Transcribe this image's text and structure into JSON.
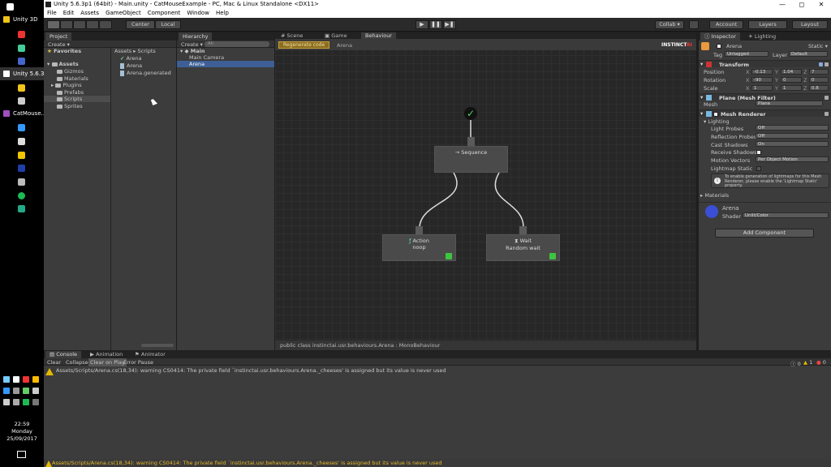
{
  "taskbar": {
    "apps": [
      {
        "label": "Unity 3D",
        "color": "#f0c419"
      },
      {
        "label": "Unity 5.6.3...",
        "color": "#ffffff"
      },
      {
        "label": "CatMouse...",
        "color": "#a04fc0"
      }
    ],
    "clock": {
      "time": "22:59",
      "day": "Monday",
      "date": "25/09/2017"
    }
  },
  "window": {
    "title": "Unity 5.6.3p1 (64bit) - Main.unity - CatMouseExample - PC, Mac & Linux Standalone <DX11>",
    "controls": {
      "minimize": "—",
      "maximize": "◻",
      "close": "✕"
    }
  },
  "menu": [
    "File",
    "Edit",
    "Assets",
    "GameObject",
    "Component",
    "Window",
    "Help"
  ],
  "toolbar": {
    "center_label": "Center",
    "local_label": "Local",
    "collab_label": "Collab ▾",
    "account_label": "Account",
    "layers_label": "Layers",
    "layout_label": "Layout",
    "play": "▶",
    "pause": "❚❚",
    "step": "▶❚"
  },
  "project": {
    "tab": "Project",
    "create": "Create ▾",
    "favorites": "Favorites",
    "assets": "Assets",
    "folders": [
      "Gizmos",
      "Materials",
      "Plugins",
      "Prefabs",
      "Scripts",
      "Sprites"
    ],
    "breadcrumb": "Assets ▸ Scripts",
    "files": [
      "Arena",
      "Arena",
      "Arena.generated"
    ]
  },
  "hierarchy": {
    "tab": "Hierarchy",
    "create": "Create ▾",
    "search_placeholder": "All",
    "scene": "Main",
    "items": [
      "Main Camera",
      "Arena"
    ]
  },
  "center_tabs": [
    "Scene",
    "Game",
    "Behaviour"
  ],
  "behaviour": {
    "regenerate": "Regenerate code",
    "object": "Arena",
    "logo": "INSTINCT",
    "logo_suffix": "AI",
    "root_icon": "✓",
    "sequence_label": "Sequence",
    "sequence_icon": "→",
    "action_title": "Action",
    "action_icon": "ƒ",
    "action_sub": "noop",
    "wait_title": "Wait",
    "wait_icon": "⧗",
    "wait_sub": "Random wait",
    "footer": "public class instinctai.usr.behaviours.Arena : MonoBehaviour"
  },
  "inspector": {
    "tabs": [
      "Inspector",
      "Lighting"
    ],
    "name": "Arena",
    "static": "Static ▾",
    "tag_label": "Tag",
    "tag": "Untagged",
    "layer_label": "Layer",
    "layer": "Default",
    "transform": "Transform",
    "position_label": "Position",
    "rotation_label": "Rotation",
    "scale_label": "Scale",
    "position": [
      "-0.13",
      "1.04",
      "7"
    ],
    "rotation": [
      "-90",
      "0",
      "0"
    ],
    "scale": [
      "1",
      "1",
      "0.8"
    ],
    "axis": [
      "X",
      "Y",
      "Z"
    ],
    "meshfilter": "Plane (Mesh Filter)",
    "mesh_label": "Mesh",
    "mesh": "Plane",
    "renderer": "Mesh Renderer",
    "lighting": "Lighting",
    "light_probes": "Light Probes",
    "light_probes_val": "Off",
    "reflection_probes": "Reflection Probes",
    "reflection_probes_val": "Off",
    "cast_shadows": "Cast Shadows",
    "cast_shadows_val": "On",
    "receive_shadows": "Receive Shadows",
    "motion_vectors": "Motion Vectors",
    "motion_vectors_val": "Per Object Motion",
    "lightmap_static": "Lightmap Static",
    "info": "To enable generation of lightmaps for this Mesh Renderer, please enable the 'Lightmap Static' property.",
    "materials": "Materials",
    "material_name": "Arena",
    "shader_label": "Shader",
    "shader": "Unlit/Color",
    "add_component": "Add Component",
    "material_color": "#3a4fd6"
  },
  "console": {
    "tabs": [
      "Console",
      "Animation",
      "Animator"
    ],
    "buttons": [
      "Clear",
      "Collapse",
      "Clear on Play",
      "Error Pause"
    ],
    "counts": [
      "0",
      "1",
      "0"
    ],
    "message": "Assets/Scripts/Arena.cs(18,34): warning CS0414: The private field `instinctai.usr.behaviours.Arena._cheeses' is assigned but its value is never used"
  },
  "status": "Assets/Scripts/Arena.cs(18,34): warning CS0414: The private field `instinctai.usr.behaviours.Arena._cheeses' is assigned but its value is never used"
}
